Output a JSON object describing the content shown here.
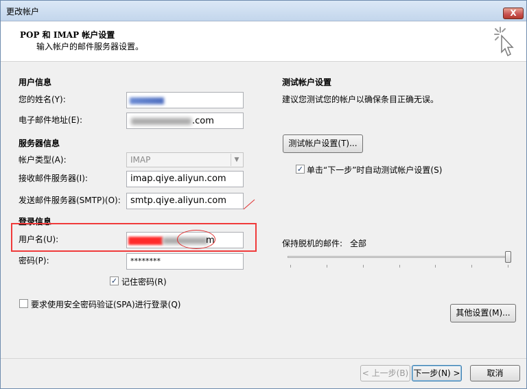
{
  "window": {
    "title": "更改帐户",
    "close_label": "X"
  },
  "header": {
    "title": "POP 和 IMAP 帐户设置",
    "subtitle": "输入帐户的邮件服务器设置。",
    "icon": "sparkle-cursor-icon"
  },
  "user_info": {
    "section_title": "用户信息",
    "name_label": "您的姓名(Y):",
    "email_label": "电子邮件地址(E):",
    "email_value_visible": ".com"
  },
  "server_info": {
    "section_title": "服务器信息",
    "account_type_label": "帐户类型(A):",
    "account_type_value": "IMAP",
    "incoming_label": "接收邮件服务器(I):",
    "incoming_value": "imap.qiye.aliyun.com",
    "outgoing_label": "发送邮件服务器(SMTP)(O):",
    "outgoing_value": "smtp.qiye.aliyun.com"
  },
  "login_info": {
    "section_title": "登录信息",
    "username_label": "用户名(U):",
    "username_value_visible": "m",
    "password_label": "密码(P):",
    "password_value": "********",
    "remember_label": "记住密码(R)",
    "remember_checked": true,
    "spa_label": "要求使用安全密码验证(SPA)进行登录(Q)",
    "spa_checked": false
  },
  "test_settings": {
    "section_title": "测试帐户设置",
    "description": "建议您测试您的帐户以确保条目正确无误。",
    "test_button": "测试帐户设置(T)...",
    "auto_test_label": "单击“下一步”时自动测试帐户设置(S)",
    "auto_test_checked": true
  },
  "offline": {
    "label": "保持脱机的邮件:",
    "value": "全部",
    "slider_fraction": 1.0
  },
  "buttons": {
    "more_settings": "其他设置(M)...",
    "back": "< 上一步(B)",
    "next": "下一步(N) >",
    "cancel": "取消"
  },
  "colors": {
    "highlight": "#f03a3a",
    "accent": "#3c7fb1"
  }
}
